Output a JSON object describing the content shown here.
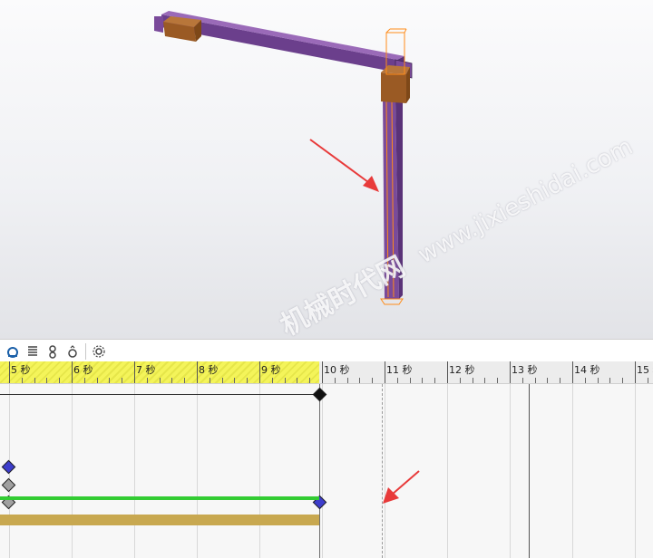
{
  "toolbar": {
    "icons": [
      "motor-icon",
      "spring-icon",
      "contact-icon",
      "gravity-icon",
      "settings-icon"
    ]
  },
  "timeline": {
    "ruler_labels": [
      "5 秒",
      "6 秒",
      "7 秒",
      "8 秒",
      "9 秒",
      "10 秒",
      "11 秒",
      "12 秒",
      "13 秒",
      "14 秒",
      "15 秒"
    ]
  },
  "watermark": {
    "line1": "机械时代网",
    "line2": "www.jixieshidai.com"
  },
  "colors": {
    "beam": "#7a4a9a",
    "bracket": "#a8622a",
    "selection": "#ff8c1a",
    "arrow": "#e83a3a",
    "green_bar": "#33cc33",
    "gold_bar": "#c8a850",
    "key_blue": "#3d3dcc",
    "key_grey": "#a0a0a0"
  }
}
